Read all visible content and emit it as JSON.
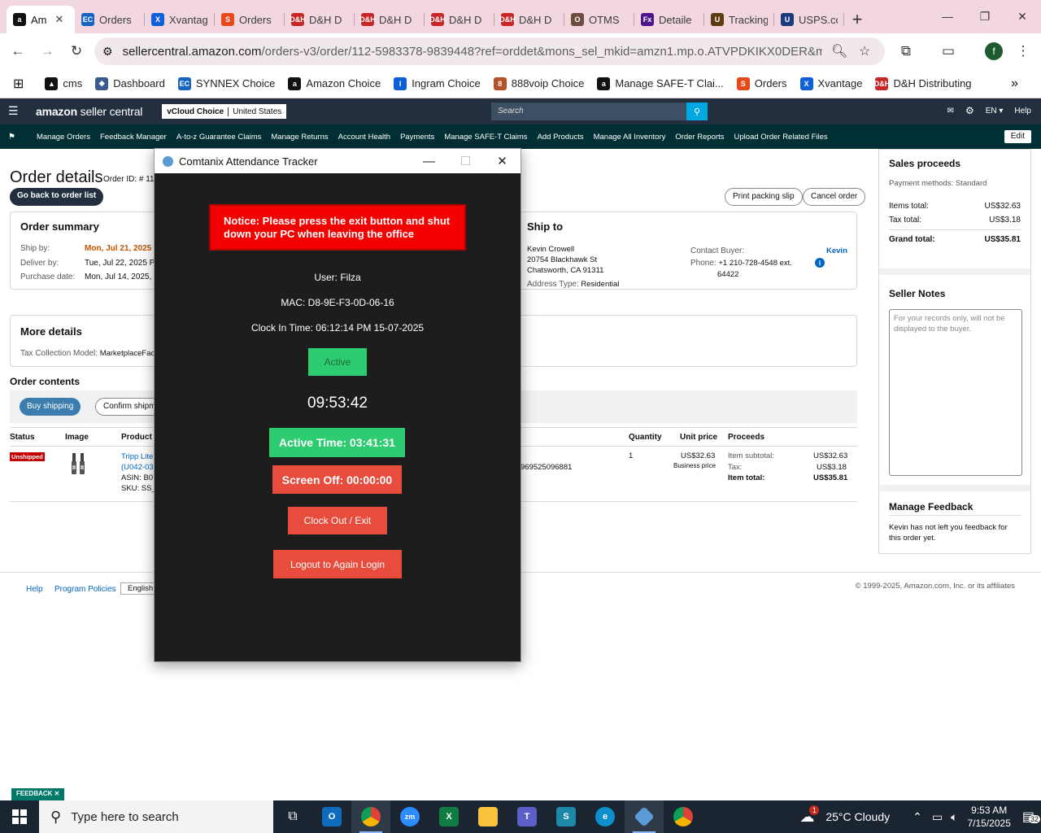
{
  "browser": {
    "tabs": [
      {
        "label": "Am",
        "icon": "amazon-icon",
        "color": "#111111",
        "glyph": "a",
        "active": true
      },
      {
        "label": "Orders",
        "icon": "synnex-icon",
        "color": "#1565c0",
        "glyph": "EC"
      },
      {
        "label": "Xvantag",
        "icon": "xvantage-icon",
        "color": "#0e5fd8",
        "glyph": "X"
      },
      {
        "label": "Orders",
        "icon": "orders-icon",
        "color": "#e64a19",
        "glyph": "S"
      },
      {
        "label": "D&H D",
        "icon": "dh-icon",
        "color": "#c62828",
        "glyph": "D&H"
      },
      {
        "label": "D&H D",
        "icon": "dh-icon",
        "color": "#c62828",
        "glyph": "D&H"
      },
      {
        "label": "D&H D",
        "icon": "dh-icon",
        "color": "#c62828",
        "glyph": "D&H"
      },
      {
        "label": "D&H D",
        "icon": "dh-icon",
        "color": "#c62828",
        "glyph": "D&H"
      },
      {
        "label": "OTMS",
        "icon": "otms-icon",
        "color": "#6d4c41",
        "glyph": "O"
      },
      {
        "label": "Detaile",
        "icon": "fedex-icon",
        "color": "#4d148c",
        "glyph": "Fx"
      },
      {
        "label": "Tracking",
        "icon": "ups-icon",
        "color": "#5c3d11",
        "glyph": "U"
      },
      {
        "label": "USPS.co",
        "icon": "usps-icon",
        "color": "#1a3a7a",
        "glyph": "U"
      }
    ],
    "url_host": "sellercentral.amazon.com",
    "url_path": "/orders-v3/order/112-5983378-9839448?ref=orddet&mons_sel_mkid=amzn1.mp.o.ATVPDKIKX0DER&mons_sel...",
    "profile_initial": "f",
    "bookmarks": [
      {
        "label": "cms",
        "icon": "cms-icon",
        "color": "#111111",
        "glyph": "▲"
      },
      {
        "label": "Dashboard",
        "icon": "dashboard-icon",
        "color": "#3b5b8c",
        "glyph": "◆"
      },
      {
        "label": "SYNNEX Choice",
        "icon": "synnex-icon",
        "color": "#1565c0",
        "glyph": "EC"
      },
      {
        "label": "Amazon Choice",
        "icon": "amazon-icon",
        "color": "#111111",
        "glyph": "a"
      },
      {
        "label": "Ingram Choice",
        "icon": "ingram-icon",
        "color": "#0e5fd8",
        "glyph": "I"
      },
      {
        "label": "888voip Choice",
        "icon": "voip-icon",
        "color": "#b5522a",
        "glyph": "8"
      },
      {
        "label": "Manage SAFE-T Clai...",
        "icon": "amazon-icon",
        "color": "#111111",
        "glyph": "a"
      },
      {
        "label": "Orders",
        "icon": "orders-icon",
        "color": "#e64a19",
        "glyph": "S"
      },
      {
        "label": "Xvantage",
        "icon": "xvantage-icon",
        "color": "#0e5fd8",
        "glyph": "X"
      },
      {
        "label": "D&H Distributing",
        "icon": "dh-icon",
        "color": "#c62828",
        "glyph": "D&H"
      }
    ]
  },
  "amazon": {
    "logo": "amazon",
    "logo_suffix": "seller central",
    "marketplace_store": "vCloud Choice",
    "marketplace_country": "United States",
    "search_placeholder": "Search",
    "lang": "EN",
    "help": "Help",
    "nav": [
      "Manage Orders",
      "Feedback Manager",
      "A-to-z Guarantee Claims",
      "Manage Returns",
      "Account Health",
      "Payments",
      "Manage SAFE-T Claims",
      "Add Products",
      "Manage All Inventory",
      "Order Reports",
      "Upload Order Related Files"
    ],
    "edit": "Edit"
  },
  "order": {
    "title": "Order details",
    "id_label": "Order ID: # 112",
    "back_button": "Go back to order list",
    "print_slip": "Print packing slip",
    "cancel_order": "Cancel order",
    "summary_title": "Order summary",
    "ship_by_label": "Ship by:",
    "ship_by_value": "Mon, Jul 21, 2025 P",
    "deliver_by_label": "Deliver by:",
    "deliver_by_value": "Tue, Jul 22, 2025 PD",
    "purchase_date_label": "Purchase date:",
    "purchase_date_value": "Mon, Jul 14, 2025, 3",
    "ship_to_title": "Ship to",
    "ship_name": "Kevin Crowell",
    "ship_street": "20754 Blackhawk St",
    "ship_city": "Chatsworth, CA 91311",
    "address_type_label": "Address Type:",
    "address_type_value": "Residential",
    "contact_label": "Contact Buyer:",
    "contact_name": "Kevin",
    "phone_label": "Phone:",
    "phone_value": "+1 210-728-4548 ext.",
    "phone_ext": "64422",
    "more_details_title": "More details",
    "tax_model_label": "Tax Collection Model:",
    "tax_model_value": "MarketplaceFaci",
    "contents_title": "Order contents",
    "buy_shipping": "Buy shipping",
    "confirm_shipment": "Confirm shipme",
    "columns": [
      "Status",
      "Image",
      "Product n",
      "Quantity",
      "Unit price",
      "Proceeds"
    ],
    "row": {
      "status": "Unshipped",
      "product_line1": "Tripp Lite",
      "product_line2": "(U042-03",
      "asin": "ASIN: B07",
      "sku": "SKU: SS_I",
      "order_item": "969525096881",
      "quantity": "1",
      "unit_price": "US$32.63",
      "unit_price_note": "Business price",
      "item_subtotal_label": "Item subtotal:",
      "item_subtotal": "US$32.63",
      "tax_label": "Tax:",
      "tax": "US$3.18",
      "item_total_label": "Item total:",
      "item_total": "US$35.81"
    }
  },
  "sidebar": {
    "proceeds_title": "Sales proceeds",
    "payment_methods": "Payment methods: Standard",
    "items_total_label": "Items total:",
    "items_total": "US$32.63",
    "tax_total_label": "Tax total:",
    "tax_total": "US$3.18",
    "grand_total_label": "Grand total:",
    "grand_total": "US$35.81",
    "notes_title": "Seller Notes",
    "notes_placeholder": "For your records only, will not be displayed to the buyer.",
    "feedback_title": "Manage Feedback",
    "feedback_text": "Kevin has not left you feedback for this order yet."
  },
  "footer": {
    "help": "Help",
    "policies": "Program Policies",
    "language": "English",
    "copyright": "© 1999-2025, Amazon.com, Inc. or its affiliates"
  },
  "tracker": {
    "title": "Comtanix Attendance Tracker",
    "notice": "Notice: Please press the exit button and shut down your PC when leaving the office",
    "user": "User: Filza",
    "mac": "MAC: D8-9E-F3-0D-06-16",
    "clock_in": "Clock In Time: 06:12:14 PM 15-07-2025",
    "status": "Active",
    "clock": "09:53:42",
    "active_time": "Active Time: 03:41:31",
    "screen_off": "Screen Off: 00:00:00",
    "clock_out": "Clock Out / Exit",
    "logout": "Logout to Again Login",
    "colors": {
      "green": "#2ecc71",
      "red": "#e74c3c",
      "notice_red": "#f40000"
    }
  },
  "taskbar": {
    "feedback_tab": "FEEDBACK",
    "search_placeholder": "Type here to search",
    "weather": "25°C  Cloudy",
    "weather_badge": "1",
    "time": "9:53 AM",
    "date": "7/15/2025",
    "notifications": "32"
  }
}
